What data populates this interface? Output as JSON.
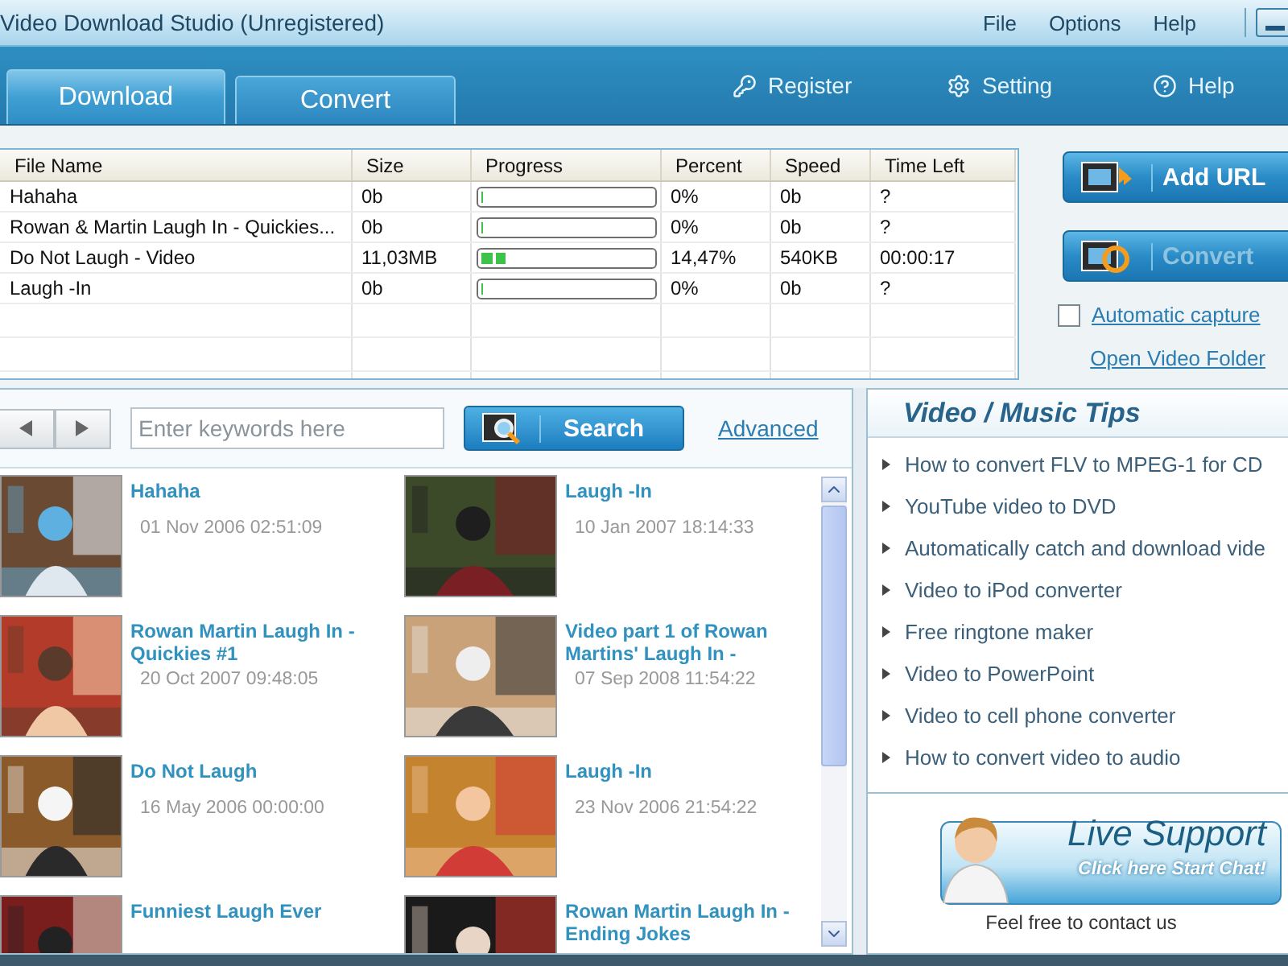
{
  "window": {
    "title": "Video Download Studio (Unregistered)"
  },
  "menu": [
    "File",
    "Options",
    "Help"
  ],
  "tabs": [
    {
      "label": "Download",
      "selected": true
    },
    {
      "label": "Convert",
      "selected": false
    }
  ],
  "toolbar_links": [
    {
      "kind": "register",
      "label": "Register"
    },
    {
      "kind": "setting",
      "label": "Setting"
    },
    {
      "kind": "help",
      "label": "Help"
    }
  ],
  "downloads": {
    "columns": [
      "File Name",
      "Size",
      "Progress",
      "Percent",
      "Speed",
      "Time Left"
    ],
    "rows": [
      {
        "file_name": "Hahaha",
        "size": "0b",
        "level": 0,
        "percent": "0%",
        "speed": "0b",
        "time_left": "?"
      },
      {
        "file_name": "Rowan & Martin  Laugh  In - Quickies...",
        "size": "0b",
        "level": 0,
        "percent": "0%",
        "speed": "0b",
        "time_left": "?"
      },
      {
        "file_name": "Do Not Laugh - Video",
        "size": "11,03MB",
        "level": 0.15,
        "percent": "14,47%",
        "speed": "540KB",
        "time_left": "00:00:17"
      },
      {
        "file_name": "Laugh  -In",
        "size": "0b",
        "level": 0,
        "percent": "0%",
        "speed": "0b",
        "time_left": "?"
      }
    ]
  },
  "actions": [
    {
      "kind": "add",
      "label": "Add URL",
      "disabled": false
    },
    {
      "kind": "convert",
      "label": "Convert",
      "disabled": true
    }
  ],
  "automatic_capture": {
    "label": "Automatic capture",
    "checked": false
  },
  "open_folder": "Open Video Folder",
  "search": {
    "placeholder": "Enter keywords here",
    "button": "Search",
    "advanced": "Advanced"
  },
  "videos": [
    {
      "title": "Hahaha",
      "date": "01 Nov 2006 02:51:09"
    },
    {
      "title": "Laugh  -In",
      "date": "10 Jan 2007 18:14:33"
    },
    {
      "title": "Rowan  Martin  Laugh  In - Quickies #1",
      "date": "20 Oct 2007 09:48:05"
    },
    {
      "title": "Video part 1 of Rowan Martins'  Laugh  In -",
      "date": "07 Sep 2008 11:54:22"
    },
    {
      "title": "Do Not  Laugh",
      "date": "16 May 2006 00:00:00"
    },
    {
      "title": "Laugh  -In",
      "date": "23 Nov 2006 21:54:22"
    },
    {
      "title": "Funniest  Laugh  Ever"
    },
    {
      "title": "Rowan  Martin  Laugh  In - Ending Jokes"
    }
  ],
  "tips": {
    "title": "Video / Music Tips",
    "items": [
      "How to convert FLV to MPEG-1 for CD",
      "YouTube video to DVD",
      "Automatically catch and download vide",
      "Video to iPod converter",
      "Free ringtone maker",
      "Video to PowerPoint",
      "Video to cell phone converter",
      "How to convert video to audio"
    ]
  },
  "live_support": {
    "title": "Live Support",
    "action": "Click here Start Chat!",
    "note": "Feel free to contact us"
  }
}
